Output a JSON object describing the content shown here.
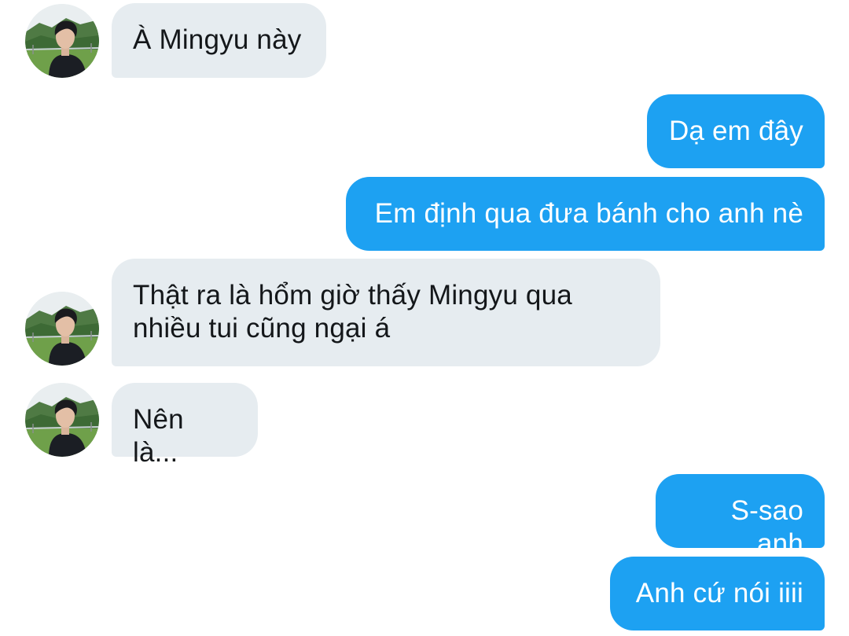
{
  "conversation": {
    "messages": [
      {
        "sender": "other",
        "text": "À Mingyu này"
      },
      {
        "sender": "me",
        "text": "Dạ em đây"
      },
      {
        "sender": "me",
        "text": "Em định qua đưa bánh cho anh nè"
      },
      {
        "sender": "other",
        "text": "Thật ra là hổm giờ thấy Mingyu qua nhiều tui cũng ngại á"
      },
      {
        "sender": "other",
        "text": "Nên là..."
      },
      {
        "sender": "me",
        "text": "S-sao anh"
      },
      {
        "sender": "me",
        "text": "Anh cứ nói iiii"
      }
    ]
  },
  "colors": {
    "sent_bubble": "#1da1f2",
    "received_bubble": "#e6ecf0",
    "received_text": "#14171a",
    "sent_text": "#ffffff"
  },
  "avatar_icon": "profile-photo-avatar"
}
